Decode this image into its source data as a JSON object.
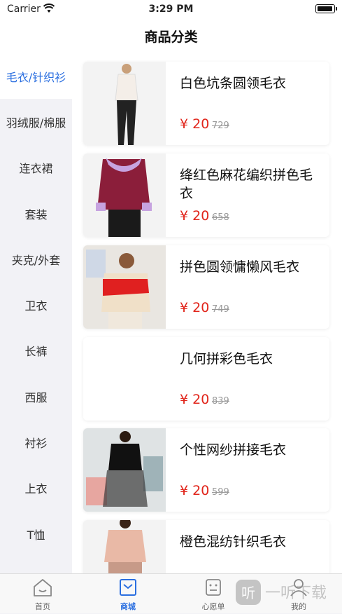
{
  "status": {
    "carrier": "Carrier",
    "time": "3:29 PM"
  },
  "nav": {
    "title": "商品分类"
  },
  "categories": [
    "毛衣/针织衫",
    "羽绒服/棉服",
    "连衣裙",
    "套装",
    "夹克/外套",
    "卫衣",
    "长裤",
    "西服",
    "衬衫",
    "上衣",
    "T恤"
  ],
  "active_category": 0,
  "products": [
    {
      "name": "白色坑条圆领毛衣",
      "price": "¥ 20",
      "old_price": "729"
    },
    {
      "name": "绛红色麻花编织拼色毛衣",
      "price": "¥ 20",
      "old_price": "658"
    },
    {
      "name": "拼色圆领慵懒风毛衣",
      "price": "¥ 20",
      "old_price": "749"
    },
    {
      "name": "几何拼彩色毛衣",
      "price": "¥ 20",
      "old_price": "839"
    },
    {
      "name": "个性网纱拼接毛衣",
      "price": "¥ 20",
      "old_price": "599"
    },
    {
      "name": "橙色混纺针织毛衣",
      "price": "",
      "old_price": ""
    }
  ],
  "tabs": [
    {
      "label": "首页",
      "icon": "home-icon"
    },
    {
      "label": "商城",
      "icon": "shop-bag-icon"
    },
    {
      "label": "心愿单",
      "icon": "wishlist-icon"
    },
    {
      "label": "我的",
      "icon": "profile-icon"
    }
  ],
  "active_tab": 1,
  "colors": {
    "accent": "#2b6fe0",
    "price": "#e1251b",
    "background": "#f2f2f6"
  },
  "watermark": "一听下载"
}
